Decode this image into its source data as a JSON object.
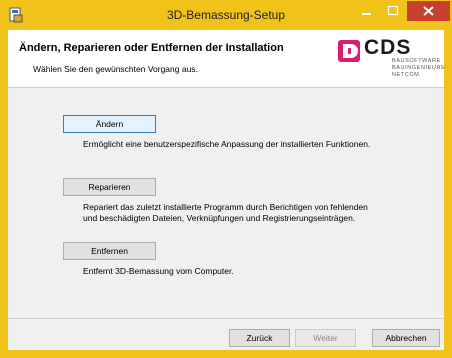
{
  "window": {
    "title": "3D-Bemassung-Setup"
  },
  "header": {
    "title": "Ändern, Reparieren oder Entfernen der Installation",
    "subtitle": "Wählen Sie den gewünschten Vorgang aus."
  },
  "logo": {
    "brand": "CDS",
    "tagline_1": "BAUSOFTWARE",
    "tagline_2": "BAUINGENIEURE",
    "tagline_3": "NETCOM",
    "accent_color": "#d81e6f"
  },
  "options": [
    {
      "button_label": "Ändern",
      "description": "Ermöglicht eine benutzerspezifische Anpassung der installierten Funktionen."
    },
    {
      "button_label": "Reparieren",
      "description_line_1": "Repariert das zuletzt installierte Programm durch Berichtigen von fehlenden",
      "description_line_2": "und beschädigten Dateien, Verknüpfungen und Registrierungseinträgen."
    },
    {
      "button_label": "Entfernen",
      "description": "Entfernt 3D-Bemassung vom Computer."
    }
  ],
  "footer": {
    "back_label": "Zurück",
    "next_label": "Weiter",
    "cancel_label": "Abbrechen"
  },
  "colors": {
    "titlebar": "#f0c21a",
    "close_button": "#c7402d"
  }
}
